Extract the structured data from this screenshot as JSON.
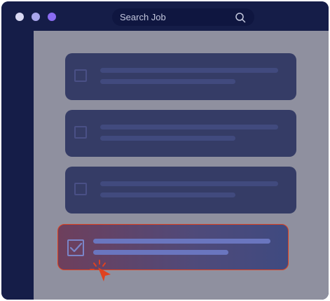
{
  "window": {
    "controls": [
      {
        "name": "window-dot-1",
        "color": "#d9d9f3"
      },
      {
        "name": "window-dot-2",
        "color": "#a9a6ec"
      },
      {
        "name": "window-dot-3",
        "color": "#8a6cf2"
      }
    ]
  },
  "search": {
    "placeholder": "Search Job",
    "icon": "search-icon"
  },
  "job_list": {
    "items": [
      {
        "checked": false,
        "state": "default"
      },
      {
        "checked": false,
        "state": "default"
      },
      {
        "checked": false,
        "state": "default"
      },
      {
        "checked": true,
        "state": "selected"
      }
    ]
  },
  "cursor": {
    "icon": "pointer-click-icon",
    "color": "#e0421f"
  },
  "colors": {
    "frame": "#151d48",
    "content_background": "#8f909f",
    "row_background": "#353c66",
    "selected_border": "#e0421f",
    "accent_line": "#6a76bf"
  }
}
